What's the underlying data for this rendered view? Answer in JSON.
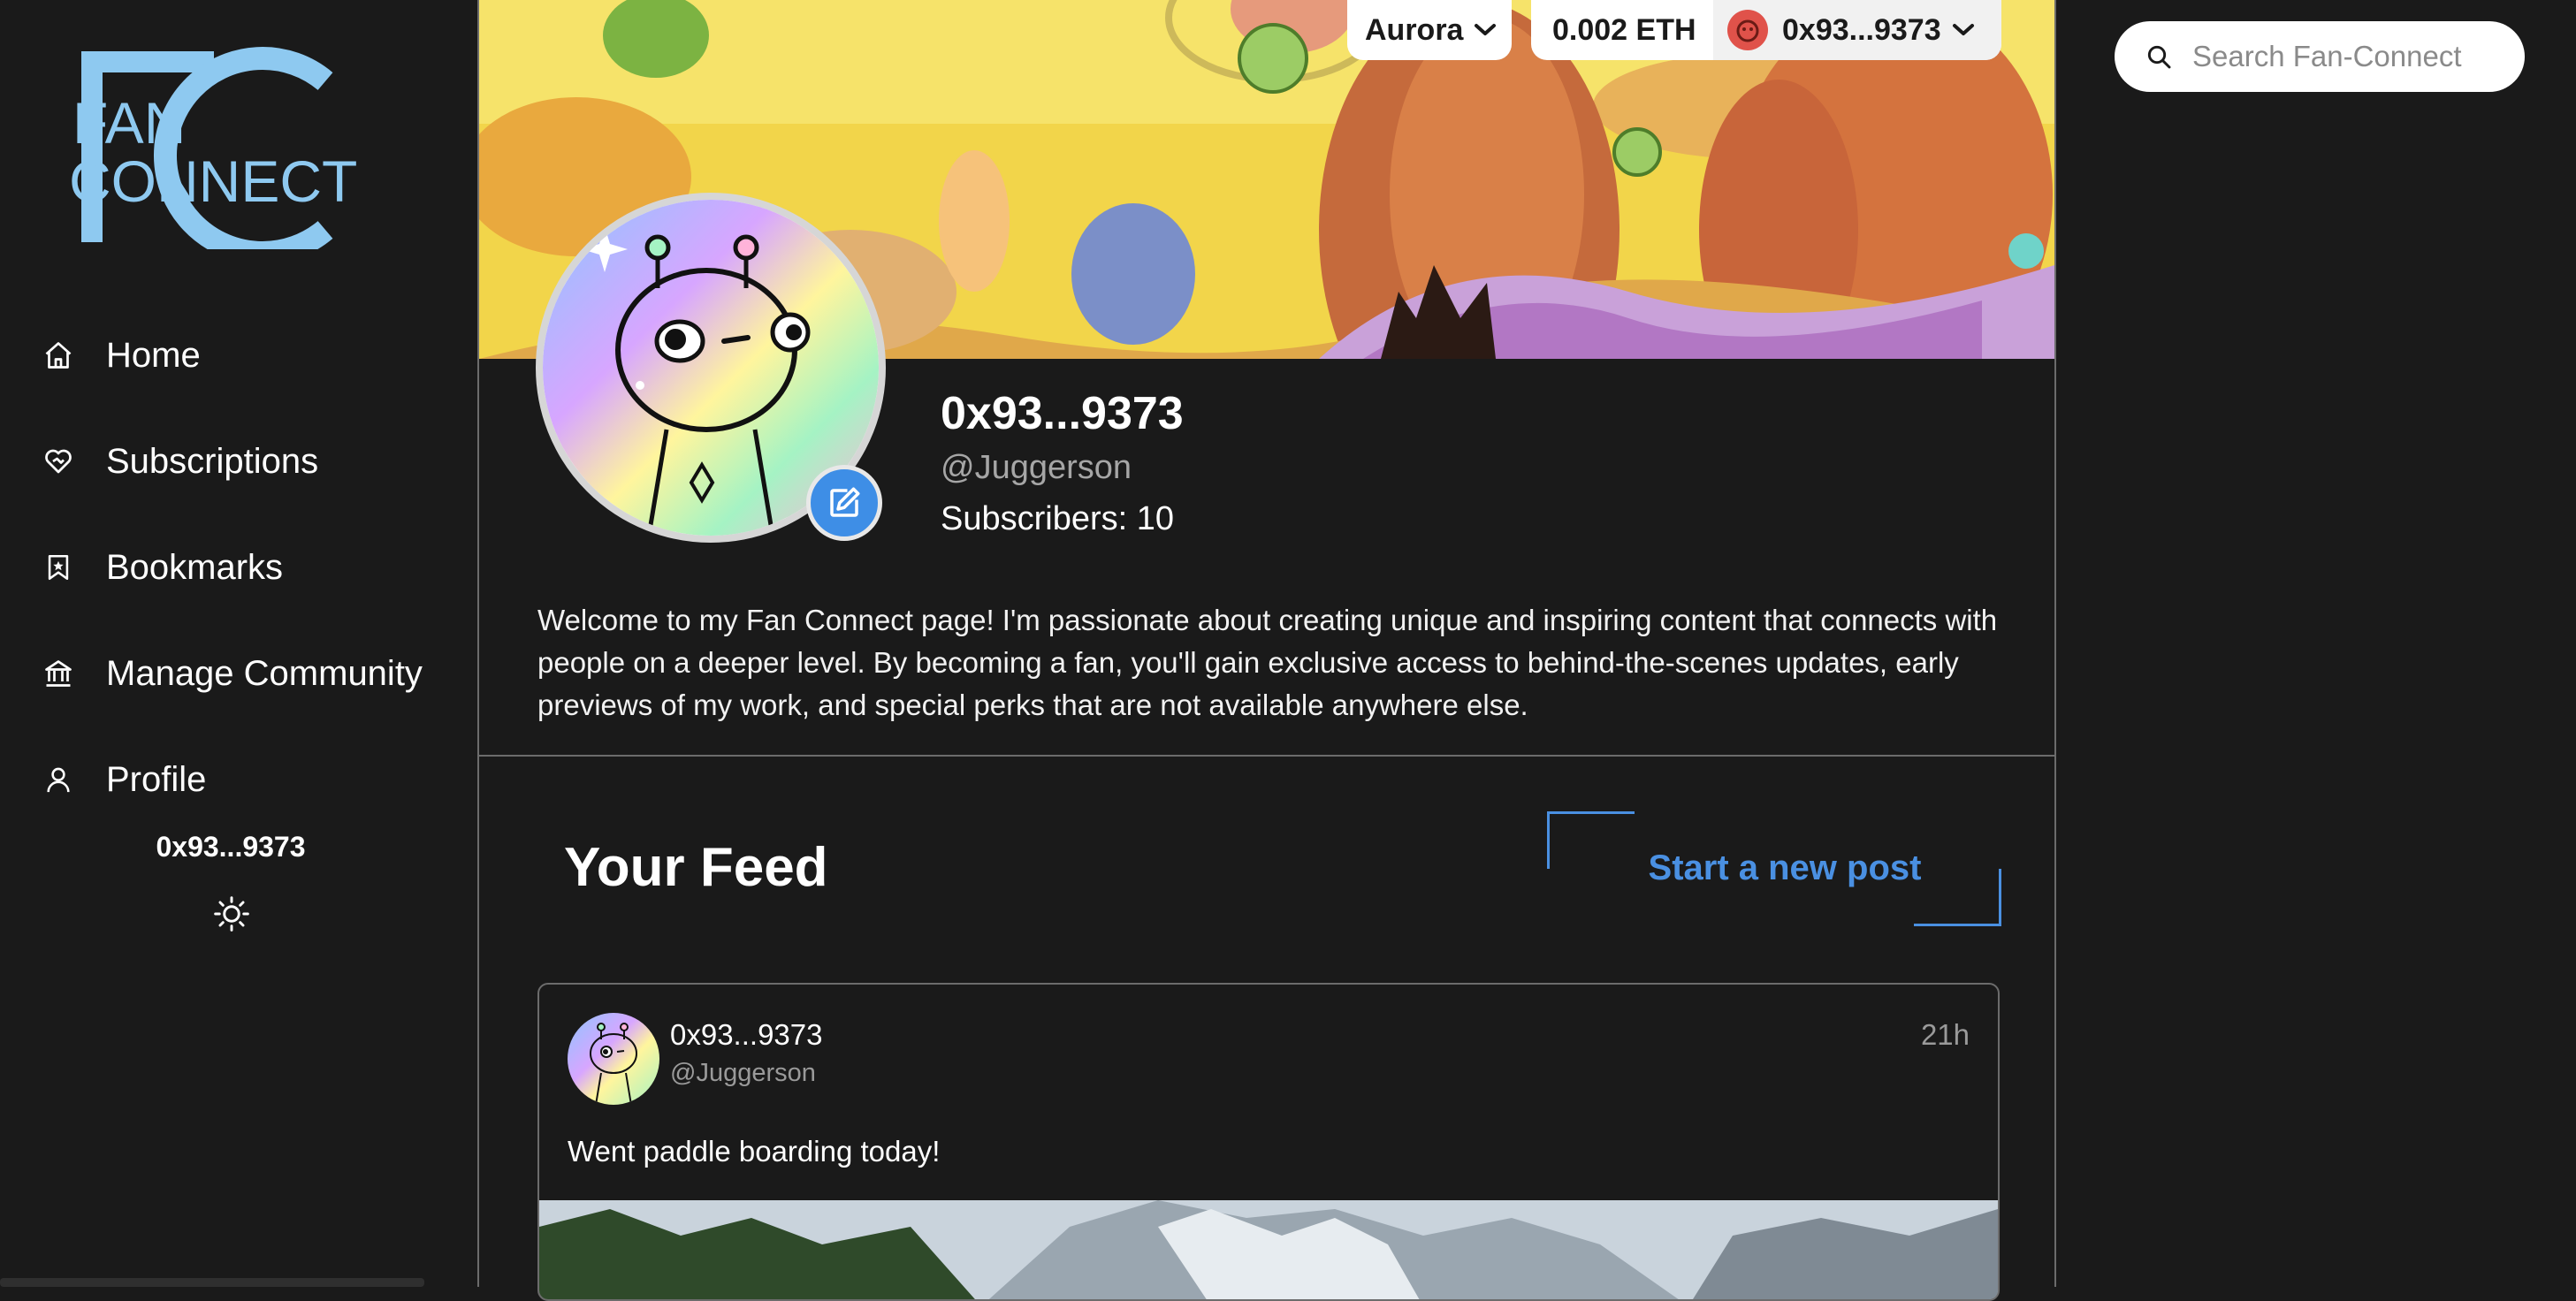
{
  "brand": {
    "logo_text_line1": "FAN",
    "logo_text_line2": "CONNECT",
    "monogram": "FC"
  },
  "nav": {
    "items": [
      {
        "label": "Home",
        "icon": "home-icon"
      },
      {
        "label": "Subscriptions",
        "icon": "heart-handshake-icon"
      },
      {
        "label": "Bookmarks",
        "icon": "bookmark-star-icon"
      },
      {
        "label": "Manage Community",
        "icon": "bank-icon"
      },
      {
        "label": "Profile",
        "icon": "user-icon"
      }
    ],
    "address": "0x93...9373",
    "theme_icon": "sun-icon"
  },
  "wallet": {
    "network": "Aurora",
    "balance": "0.002 ETH",
    "account": "0x93...9373"
  },
  "profile": {
    "name": "0x93...9373",
    "handle": "@Juggerson",
    "subscribers": "Subscribers: 10",
    "bio": "Welcome to my Fan Connect page! I'm passionate about creating unique and inspiring content that connects with people on a deeper level. By becoming a fan, you'll gain exclusive access to behind-the-scenes updates, early previews of my work, and special perks that are not available anywhere else."
  },
  "feed": {
    "title": "Your Feed",
    "new_post_label": "Start a new post",
    "posts": [
      {
        "author": "0x93...9373",
        "handle": "@Juggerson",
        "time": "21h",
        "text": "Went paddle boarding today!"
      }
    ]
  },
  "search": {
    "placeholder": "Search Fan-Connect"
  },
  "colors": {
    "accent": "#4a90e2",
    "background": "#1a1a1a",
    "border": "#6c6c6c"
  }
}
